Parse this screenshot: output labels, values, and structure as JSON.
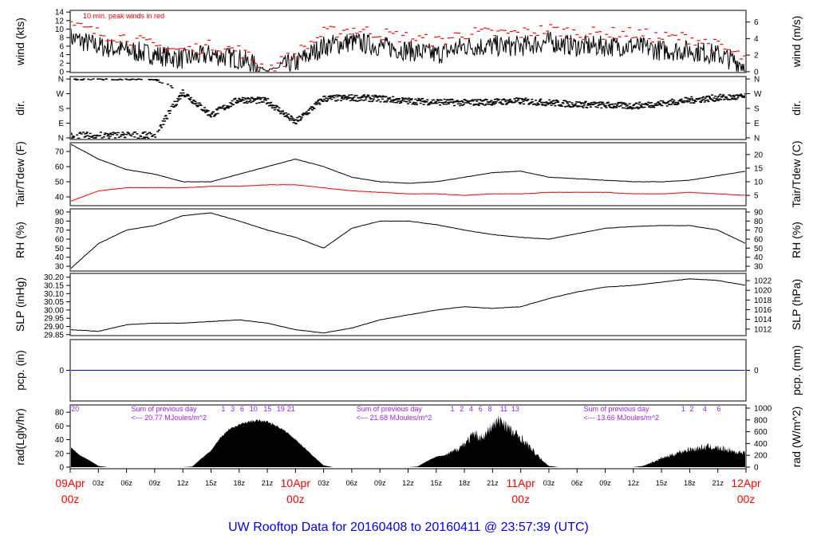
{
  "chart_data": {
    "type": "line",
    "title": "UW Rooftop Data for 20160408  to  20160411 @ 23:57:39  (UTC)",
    "x_unit": "hours since 09Apr 00z",
    "xlim": [
      0,
      72
    ],
    "x_ticks": [
      {
        "h": 0,
        "label": "09Apr",
        "sub": "00z",
        "major": true
      },
      {
        "h": 3,
        "label": "03z"
      },
      {
        "h": 6,
        "label": "06z"
      },
      {
        "h": 9,
        "label": "09z"
      },
      {
        "h": 12,
        "label": "12z"
      },
      {
        "h": 15,
        "label": "15z"
      },
      {
        "h": 18,
        "label": "18z"
      },
      {
        "h": 21,
        "label": "21z"
      },
      {
        "h": 24,
        "label": "10Apr",
        "sub": "00z",
        "major": true
      },
      {
        "h": 27,
        "label": "03z"
      },
      {
        "h": 30,
        "label": "06z"
      },
      {
        "h": 33,
        "label": "09z"
      },
      {
        "h": 36,
        "label": "12z"
      },
      {
        "h": 39,
        "label": "15z"
      },
      {
        "h": 42,
        "label": "18z"
      },
      {
        "h": 45,
        "label": "21z"
      },
      {
        "h": 48,
        "label": "11Apr",
        "sub": "00z",
        "major": true
      },
      {
        "h": 51,
        "label": "03z"
      },
      {
        "h": 54,
        "label": "06z"
      },
      {
        "h": 57,
        "label": "09z"
      },
      {
        "h": 60,
        "label": "12z"
      },
      {
        "h": 63,
        "label": "15z"
      },
      {
        "h": 66,
        "label": "18z"
      },
      {
        "h": 69,
        "label": "21z"
      },
      {
        "h": 72,
        "label": "12Apr",
        "sub": "00z",
        "major": true
      }
    ],
    "panels": [
      {
        "id": "wind",
        "ylabel": "wind (kts)",
        "ylabel_right": "wind (m/s)",
        "ylim": [
          -0.2,
          14.4
        ],
        "yticks": [
          {
            "v": 0,
            "label": "0"
          },
          {
            "v": 2,
            "label": "2"
          },
          {
            "v": 4,
            "label": "4"
          },
          {
            "v": 6,
            "label": "6"
          },
          {
            "v": 8,
            "label": "8"
          },
          {
            "v": 10,
            "label": "10"
          },
          {
            "v": 12,
            "label": "12"
          },
          {
            "v": 14,
            "label": "14"
          }
        ],
        "yticks_right": [
          {
            "v": 0,
            "label": "0"
          },
          {
            "v": 3.89,
            "label": "2"
          },
          {
            "v": 7.78,
            "label": "4"
          },
          {
            "v": 11.66,
            "label": "6"
          }
        ],
        "legend": "10 min. peak winds in red",
        "x_step_hours": 3,
        "series": [
          {
            "name": "wind speed",
            "color": "#000000",
            "values": [
              8,
              6,
              5,
              4,
              3,
              4,
              3,
              0.3,
              2,
              6,
              7,
              6,
              5,
              4,
              6,
              6,
              6,
              7,
              6,
              6,
              6,
              5,
              5,
              4,
              1.5
            ]
          },
          {
            "name": "10 min. peak",
            "color": "#ff0000",
            "values": [
              11,
              9,
              8,
              6,
              5,
              6,
              5,
              0.5,
              4,
              9,
              10,
              9,
              8,
              7,
              9,
              9,
              9,
              10,
              9,
              9,
              9,
              8,
              8,
              6,
              3
            ]
          }
        ]
      },
      {
        "id": "dir",
        "ylabel": "dir.",
        "ylabel_right": "dir.",
        "ylim": [
          -10,
          375
        ],
        "yticks": [
          {
            "v": 0,
            "label": "N"
          },
          {
            "v": 90,
            "label": "E"
          },
          {
            "v": 180,
            "label": "S"
          },
          {
            "v": 270,
            "label": "W"
          },
          {
            "v": 360,
            "label": "N"
          }
        ],
        "yticks_right": [
          {
            "v": 0,
            "label": "N"
          },
          {
            "v": 90,
            "label": "E"
          },
          {
            "v": 180,
            "label": "S"
          },
          {
            "v": 270,
            "label": "W"
          },
          {
            "v": 360,
            "label": "N"
          }
        ],
        "x_step_hours": 3,
        "series": [
          {
            "name": "wind direction (deg)",
            "color": "#000000",
            "values": [
              15,
              15,
              18,
              15,
              280,
              140,
              235,
              225,
              95,
              240,
              245,
              240,
              225,
              220,
              215,
              220,
              225,
              215,
              205,
              200,
              195,
              210,
              230,
              245,
              250
            ]
          }
        ]
      },
      {
        "id": "temp",
        "ylabel": "Tair/Tdew (F)",
        "ylabel_right": "Tair/Tdew (C)",
        "ylim": [
          34.2,
          75.8
        ],
        "yticks": [
          {
            "v": 40,
            "label": "40"
          },
          {
            "v": 50,
            "label": "50"
          },
          {
            "v": 60,
            "label": "60"
          },
          {
            "v": 70,
            "label": "70"
          }
        ],
        "yticks_right": [
          {
            "v": 41,
            "label": "5"
          },
          {
            "v": 50,
            "label": "10"
          },
          {
            "v": 59,
            "label": "15"
          },
          {
            "v": 68,
            "label": "20"
          }
        ],
        "x_step_hours": 3,
        "series": [
          {
            "name": "Tair",
            "color": "#000000",
            "values": [
              75,
              65,
              58,
              55,
              50,
              50,
              55,
              60,
              65,
              60,
              53,
              50,
              49,
              50,
              53,
              56,
              57,
              53,
              52,
              51,
              50,
              50,
              51,
              54,
              57
            ]
          },
          {
            "name": "Tdew",
            "color": "#ff0000",
            "values": [
              37,
              44,
              46,
              46,
              46,
              47,
              47,
              48,
              48,
              46,
              44,
              43,
              42,
              42,
              41,
              42,
              42,
              43,
              43,
              43,
              42,
              42,
              43,
              42,
              41
            ]
          }
        ]
      },
      {
        "id": "rh",
        "ylabel": "RH (%)",
        "ylabel_right": "RH (%)",
        "ylim": [
          24.7,
          93.5
        ],
        "yticks": [
          {
            "v": 30,
            "label": "30"
          },
          {
            "v": 40,
            "label": "40"
          },
          {
            "v": 50,
            "label": "50"
          },
          {
            "v": 60,
            "label": "60"
          },
          {
            "v": 70,
            "label": "70"
          },
          {
            "v": 80,
            "label": "80"
          },
          {
            "v": 90,
            "label": "90"
          }
        ],
        "yticks_right": [
          {
            "v": 30,
            "label": "30"
          },
          {
            "v": 40,
            "label": "40"
          },
          {
            "v": 50,
            "label": "50"
          },
          {
            "v": 60,
            "label": "60"
          },
          {
            "v": 70,
            "label": "70"
          },
          {
            "v": 80,
            "label": "80"
          },
          {
            "v": 90,
            "label": "90"
          }
        ],
        "x_step_hours": 3,
        "series": [
          {
            "name": "RH",
            "color": "#000000",
            "values": [
              27,
              55,
              70,
              75,
              86,
              89,
              80,
              70,
              62,
              50,
              72,
              80,
              80,
              76,
              70,
              65,
              62,
              60,
              66,
              72,
              74,
              75,
              75,
              70,
              55
            ]
          }
        ]
      },
      {
        "id": "slp",
        "ylabel": "SLP (inHg)",
        "ylabel_right": "SLP (hPa)",
        "ylim": [
          29.844,
          30.223
        ],
        "yticks": [
          {
            "v": 29.85,
            "label": "29.85"
          },
          {
            "v": 29.9,
            "label": "29.90"
          },
          {
            "v": 29.95,
            "label": "29.95"
          },
          {
            "v": 30.0,
            "label": "30.00"
          },
          {
            "v": 30.05,
            "label": "30.05"
          },
          {
            "v": 30.1,
            "label": "30.10"
          },
          {
            "v": 30.15,
            "label": "30.15"
          },
          {
            "v": 30.2,
            "label": "30.20"
          }
        ],
        "yticks_right": [
          {
            "v": 29.884,
            "label": "1012"
          },
          {
            "v": 29.943,
            "label": "1014"
          },
          {
            "v": 30.002,
            "label": "1016"
          },
          {
            "v": 30.061,
            "label": "1018"
          },
          {
            "v": 30.12,
            "label": "1020"
          },
          {
            "v": 30.179,
            "label": "1022"
          }
        ],
        "x_step_hours": 3,
        "series": [
          {
            "name": "SLP",
            "color": "#000000",
            "values": [
              29.88,
              29.87,
              29.91,
              29.92,
              29.92,
              29.93,
              29.94,
              29.92,
              29.88,
              29.86,
              29.89,
              29.94,
              29.97,
              30.0,
              30.02,
              30.01,
              30.02,
              30.07,
              30.11,
              30.14,
              30.15,
              30.17,
              30.19,
              30.18,
              30.15
            ]
          }
        ]
      },
      {
        "id": "pcp",
        "ylabel": "pcp. (in)",
        "ylabel_right": "pcp. (mm)",
        "ylim": [
          -1,
          1
        ],
        "yticks": [
          {
            "v": 0,
            "label": "0"
          }
        ],
        "yticks_right": [
          {
            "v": 0,
            "label": "0"
          }
        ],
        "x_step_hours": 3,
        "series": [
          {
            "name": "precipitation",
            "color": "#0000ff",
            "values": [
              0,
              0,
              0,
              0,
              0,
              0,
              0,
              0,
              0,
              0,
              0,
              0,
              0,
              0,
              0,
              0,
              0,
              0,
              0,
              0,
              0,
              0,
              0,
              0,
              0
            ]
          }
        ]
      },
      {
        "id": "rad",
        "type": "area",
        "ylabel": "rad(Lgly/hr)",
        "ylabel_right": "rad (W/m^2)",
        "ylim": [
          -27,
          1054
        ],
        "yticks": [
          {
            "v": 0,
            "label": "0"
          },
          {
            "v": 232.6,
            "label": "20"
          },
          {
            "v": 465.2,
            "label": "40"
          },
          {
            "v": 697.8,
            "label": "60"
          },
          {
            "v": 930.4,
            "label": "80"
          }
        ],
        "yticks_right": [
          {
            "v": 0,
            "label": "0"
          },
          {
            "v": 200,
            "label": "200"
          },
          {
            "v": 400,
            "label": "400"
          },
          {
            "v": 600,
            "label": "600"
          },
          {
            "v": 800,
            "label": "800"
          },
          {
            "v": 1000,
            "label": "1000"
          }
        ],
        "x_step_hours": 1,
        "series": [
          {
            "name": "solar radiation (W/m^2)",
            "color": "#000000",
            "values": [
              350,
              200,
              120,
              20,
              0,
              0,
              0,
              0,
              0,
              0,
              0,
              0,
              0,
              10,
              150,
              280,
              500,
              650,
              720,
              770,
              790,
              770,
              700,
              600,
              470,
              320,
              170,
              30,
              0,
              0,
              0,
              0,
              0,
              0,
              0,
              0,
              0,
              10,
              100,
              180,
              200,
              280,
              400,
              550,
              500,
              700,
              800,
              600,
              500,
              330,
              160,
              20,
              0,
              0,
              0,
              0,
              0,
              0,
              0,
              0,
              0,
              20,
              80,
              150,
              200,
              260,
              300,
              320,
              350,
              320,
              300,
              250,
              260
            ]
          }
        ],
        "annotations": [
          {
            "h": 0.1,
            "row": 1,
            "text": "20"
          },
          {
            "h": 6.5,
            "row": 1,
            "text": "Sum of previous day"
          },
          {
            "h": 6.5,
            "row": 2,
            "text": "<--- 20.77 MJoules/m^2"
          },
          {
            "h": 16.1,
            "row": 1,
            "text": "1"
          },
          {
            "h": 17.1,
            "row": 1,
            "text": "3"
          },
          {
            "h": 18.1,
            "row": 1,
            "text": "6"
          },
          {
            "h": 19.1,
            "row": 1,
            "text": "10"
          },
          {
            "h": 20.6,
            "row": 1,
            "text": "15"
          },
          {
            "h": 22,
            "row": 1,
            "text": "19"
          },
          {
            "h": 23.1,
            "row": 1,
            "text": "21"
          },
          {
            "h": 30.5,
            "row": 1,
            "text": "Sum of previous day"
          },
          {
            "h": 30.5,
            "row": 2,
            "text": "<--- 21.68 MJoules/m^2"
          },
          {
            "h": 40.5,
            "row": 1,
            "text": "1"
          },
          {
            "h": 41.5,
            "row": 1,
            "text": "2"
          },
          {
            "h": 42.5,
            "row": 1,
            "text": "4"
          },
          {
            "h": 43.5,
            "row": 1,
            "text": "6"
          },
          {
            "h": 44.5,
            "row": 1,
            "text": "8"
          },
          {
            "h": 45.8,
            "row": 1,
            "text": "11"
          },
          {
            "h": 47,
            "row": 1,
            "text": "13"
          },
          {
            "h": 54.7,
            "row": 1,
            "text": "Sum of previous day"
          },
          {
            "h": 54.7,
            "row": 2,
            "text": "<--- 13.66 MJoules/m^2"
          },
          {
            "h": 65.1,
            "row": 1,
            "text": "1"
          },
          {
            "h": 66,
            "row": 1,
            "text": "2"
          },
          {
            "h": 67.4,
            "row": 1,
            "text": "4"
          },
          {
            "h": 68.9,
            "row": 1,
            "text": "6"
          }
        ]
      }
    ]
  }
}
